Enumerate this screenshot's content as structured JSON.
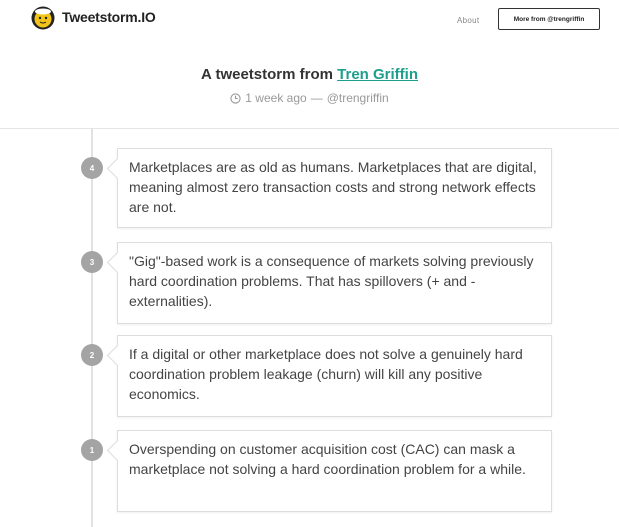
{
  "header": {
    "brand": "Tweetstorm.IO",
    "about_label": "About",
    "more_button_label": "More from @trengriffin"
  },
  "storm": {
    "title_prefix": "A tweetstorm from",
    "author_name": "Tren Griffin",
    "time_ago": "1 week ago",
    "separator": "—",
    "handle": "@trengriffin"
  },
  "tweets": [
    {
      "number": "4",
      "text": "Marketplaces are as old as humans. Marketplaces that are digital, meaning almost zero transaction costs and strong network effects are not."
    },
    {
      "number": "3",
      "text": "\"Gig\"-based work is a consequence of markets solving previously hard coordination problems. That has spillovers (+ and - externalities)."
    },
    {
      "number": "2",
      "text": "If a digital or other marketplace does not solve a genuinely hard coordination problem leakage (churn) will kill any positive economics."
    },
    {
      "number": "1",
      "text": "Overspending on customer acquisition cost (CAC) can mask a marketplace not solving a hard coordination problem for a while."
    }
  ],
  "colors": {
    "accent": "#1e9e8c",
    "badge": "#a4a4a4",
    "logo_yellow": "#f2c318"
  }
}
